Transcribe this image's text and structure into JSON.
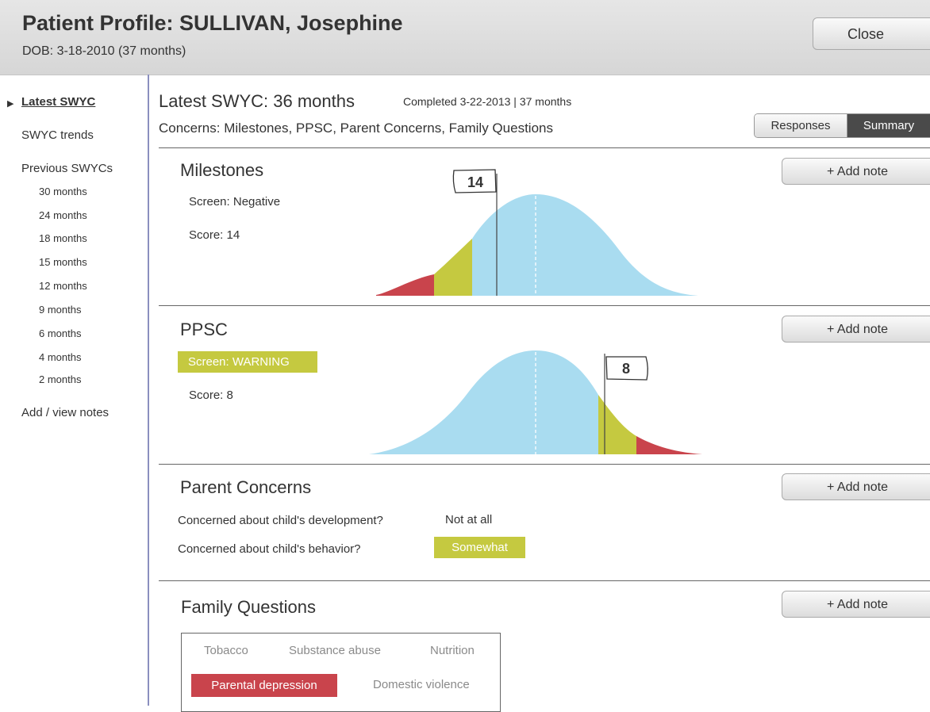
{
  "header": {
    "title": "Patient Profile: SULLIVAN, Josephine",
    "dob": "DOB: 3-18-2010 (37 months)",
    "close_label": "Close"
  },
  "sidebar": {
    "latest": "Latest SWYC",
    "trends": "SWYC trends",
    "previous": "Previous SWYCs",
    "previous_items": [
      "30 months",
      "24 months",
      "18 months",
      "15 months",
      "12 months",
      "9 months",
      "6 months",
      "4 months",
      "2 months"
    ],
    "notes": "Add / view notes"
  },
  "main": {
    "title": "Latest SWYC: 36 months",
    "completed": "Completed 3-22-2013 | 37 months",
    "concerns": "Concerns: Milestones, PPSC, Parent Concerns, Family Questions",
    "toggle": {
      "responses": "Responses",
      "summary": "Summary",
      "selected": "Summary"
    }
  },
  "add_note_label": "+ Add note",
  "milestones": {
    "title": "Milestones",
    "screen": "Screen: Negative",
    "score_label": "Score: 14",
    "flag": "14"
  },
  "ppsc": {
    "title": "PPSC",
    "screen": "Screen: WARNING",
    "score_label": "Score: 8",
    "flag": "8"
  },
  "parent_concerns": {
    "title": "Parent Concerns",
    "rows": [
      {
        "question": "Concerned about child's development?",
        "answer": "Not at all",
        "flagged": false
      },
      {
        "question": "Concerned about child's behavior?",
        "answer": "Somewhat",
        "flagged": true
      }
    ]
  },
  "family_questions": {
    "title": "Family Questions",
    "items": [
      {
        "label": "Tobacco",
        "flagged": false
      },
      {
        "label": "Substance abuse",
        "flagged": false
      },
      {
        "label": "Nutrition",
        "flagged": false
      },
      {
        "label": "Parental depression",
        "flagged": true
      },
      {
        "label": "Domestic violence",
        "flagged": false
      }
    ]
  },
  "colors": {
    "curve": "#a9dcf0",
    "warning": "#c5c940",
    "alert": "#c9444c",
    "toggle_selected": "#4a4a4a"
  }
}
